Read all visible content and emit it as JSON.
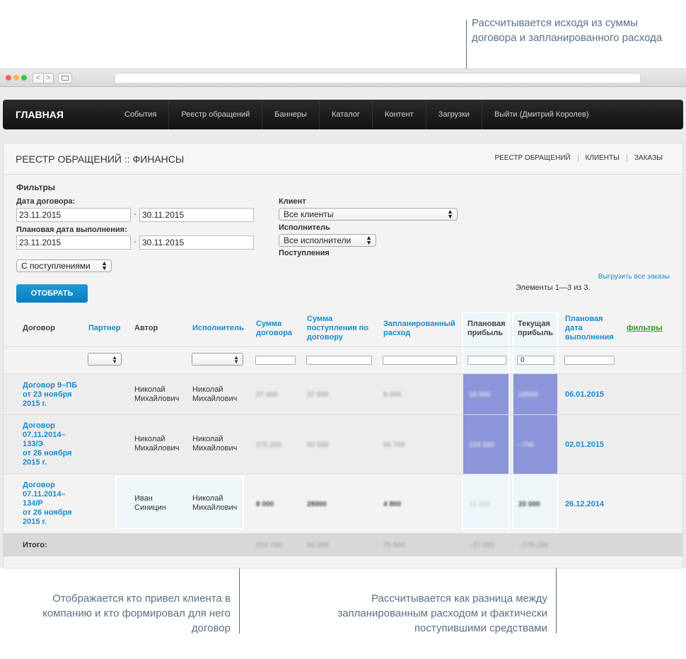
{
  "callouts": {
    "top": "Рассчитывается исходя из суммы договора и запланированного расхода",
    "bottom_left": "Отображается кто привел клиента в компанию и кто формировал для него договор",
    "bottom_right": "Рассчитывается как разница между запланированным расходом и фактически поступившими средствами"
  },
  "browser": {
    "nav_back": "<",
    "nav_forward": ">"
  },
  "nav": {
    "brand": "ГЛАВНАЯ",
    "items": [
      "События",
      "Реестр обращений",
      "Баннеры",
      "Каталог",
      "Контент",
      "Загрузки",
      "Выйти (Дмитрий Королев)"
    ]
  },
  "page": {
    "title": "РЕЕСТР ОБРАЩЕНИЙ :: ФИНАНСЫ",
    "links": [
      "РЕЕСТР ОБРАЩЕНИЙ",
      "КЛИЕНТЫ",
      "ЗАКАЗЫ"
    ]
  },
  "filters": {
    "heading": "Фильтры",
    "contract_date_label": "Дата договора:",
    "contract_from": "23.11.2015",
    "contract_to": "30.11.2015",
    "planned_date_label": "Плановая дата выполнения:",
    "planned_from": "23.11.2015",
    "planned_to": "30.11.2015",
    "separator": "-",
    "client_label": "Клиент",
    "client_value": "Все клиенты",
    "executor_label": "Исполнитель",
    "executor_value": "Все исполнители",
    "income_label": "Поступления",
    "income_value": "С поступлениями",
    "submit": "ОТОБРАТЬ",
    "export": "Выгрузить все заказы",
    "count": "Элементы 1—3 из 3."
  },
  "table": {
    "headers": {
      "contract": "Договор",
      "partner": "Партнер",
      "author": "Автор",
      "executor": "Исполнитель",
      "contract_sum": "Сумма договора",
      "income_sum": "Сумма поступления по договору",
      "planned_expense": "Запланированный расход",
      "planned_profit": "Плановая прибыль",
      "current_profit": "Текущая прибыль",
      "planned_date": "Плановая дата выполнения",
      "filters": "фильтры"
    },
    "filter_current_profit": "0",
    "rows": [
      {
        "contract": [
          "Договор 9–ПБ",
          "от 23 ноября",
          "2015 г."
        ],
        "author": [
          "Николай",
          "Михайлович"
        ],
        "executor": [
          "Николай",
          "Михайлович"
        ],
        "contract_sum": "27 000",
        "income_sum": "27 000",
        "planned_expense": "9 000",
        "planned_profit": "18 500",
        "current_profit": "18500",
        "planned_date": "06.01.2015"
      },
      {
        "contract": [
          "Договор",
          "07.11.2014–",
          "133/Э",
          "от 26 ноября",
          "2015 г."
        ],
        "author": [
          "Николай",
          "Михайлович"
        ],
        "executor": [
          "Николай",
          "Михайлович"
        ],
        "contract_sum": "175 200",
        "income_sum": "50 000",
        "planned_expense": "50 700",
        "planned_profit": "124 500",
        "current_profit": "–700",
        "planned_date": "02.01.2015"
      },
      {
        "contract": [
          "Договор",
          "07.11.2014–",
          "134/Р",
          "от 26 ноября",
          "2015 г."
        ],
        "author": [
          "Иван",
          "Синицин"
        ],
        "executor": [
          "Николай",
          "Михайлович"
        ],
        "contract_sum": "8 000",
        "income_sum": "28000",
        "planned_expense": "4 800",
        "planned_profit": "23 200",
        "current_profit": "20 000",
        "planned_date": "26.12.2014"
      }
    ],
    "total": {
      "label": "Итого:",
      "contract_sum": "210 700",
      "income_sum": "36 500",
      "planned_expense": "75 500",
      "planned_profit": "–37 000",
      "current_profit": "–179 200"
    }
  },
  "colors": {
    "accent": "#1a8ad0",
    "highlight": "#8c95d9",
    "callout": "#5a7086"
  }
}
